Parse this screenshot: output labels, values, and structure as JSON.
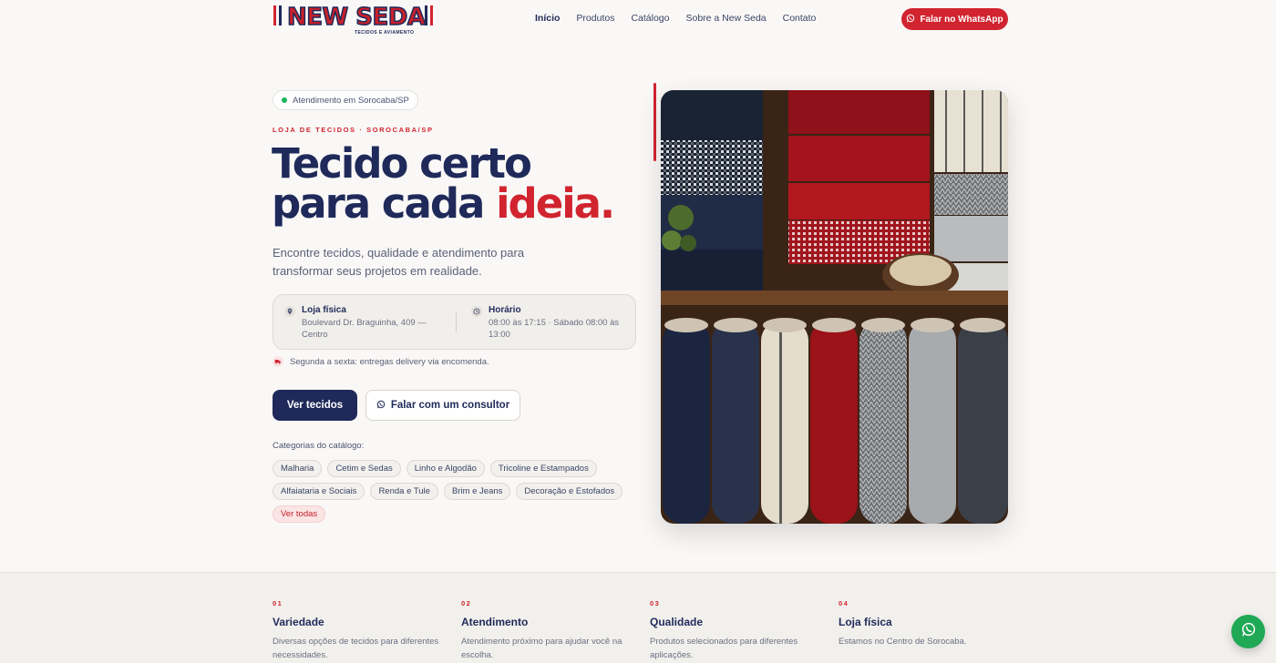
{
  "brand": {
    "name": "NEW SEDA",
    "tagline": "TECIDOS E AVIAMENTO",
    "colors": {
      "navy": "#1f2a5a",
      "red": "#d1242f",
      "green": "#1fa855"
    }
  },
  "nav": {
    "items": [
      {
        "label": "Início",
        "active": true
      },
      {
        "label": "Produtos"
      },
      {
        "label": "Catálogo"
      },
      {
        "label": "Sobre a New Seda"
      },
      {
        "label": "Contato"
      }
    ],
    "cta": {
      "label": "Falar no WhatsApp",
      "icon": "whatsapp-icon"
    }
  },
  "hero": {
    "badge": "Atendimento em Sorocaba/SP",
    "eyebrow": "LOJA DE TECIDOS · SOROCABA/SP",
    "title_line1": "Tecido certo",
    "title_line2_prefix": "para cada ",
    "title_line2_accent": "ideia.",
    "subtitle": "Encontre tecidos, qualidade e atendimento para transformar seus projetos em realidade.",
    "info": {
      "store": {
        "title": "Loja física",
        "detail": "Boulevard Dr. Braguinha, 409 — Centro",
        "icon": "map-pin-icon"
      },
      "hours": {
        "title": "Horário",
        "detail": "08:00 às 17:15 · Sábado 08:00 às 13:00",
        "icon": "clock-icon"
      }
    },
    "delivery": {
      "text": "Segunda a sexta: entregas delivery via encomenda.",
      "icon": "truck-icon"
    },
    "primary_button": "Ver tecidos",
    "secondary_button": "Falar com um consultor",
    "categories_label": "Categorias do catálogo:",
    "categories": [
      "Malharia",
      "Cetim e Sedas",
      "Linho e Algodão",
      "Tricoline e Estampados",
      "Alfaiataria e Sociais",
      "Renda e Tule",
      "Brim e Jeans",
      "Decoração e Estofados"
    ],
    "see_all": "Ver todas"
  },
  "features": [
    {
      "num": "01",
      "title": "Variedade",
      "desc": "Diversas opções de tecidos para diferentes necessidades."
    },
    {
      "num": "02",
      "title": "Atendimento",
      "desc": "Atendimento próximo para ajudar você na escolha."
    },
    {
      "num": "03",
      "title": "Qualidade",
      "desc": "Produtos selecionados para diferentes aplicações."
    },
    {
      "num": "04",
      "title": "Loja física",
      "desc": "Estamos no Centro de Sorocaba."
    }
  ],
  "floating": {
    "icon": "whatsapp-icon"
  }
}
